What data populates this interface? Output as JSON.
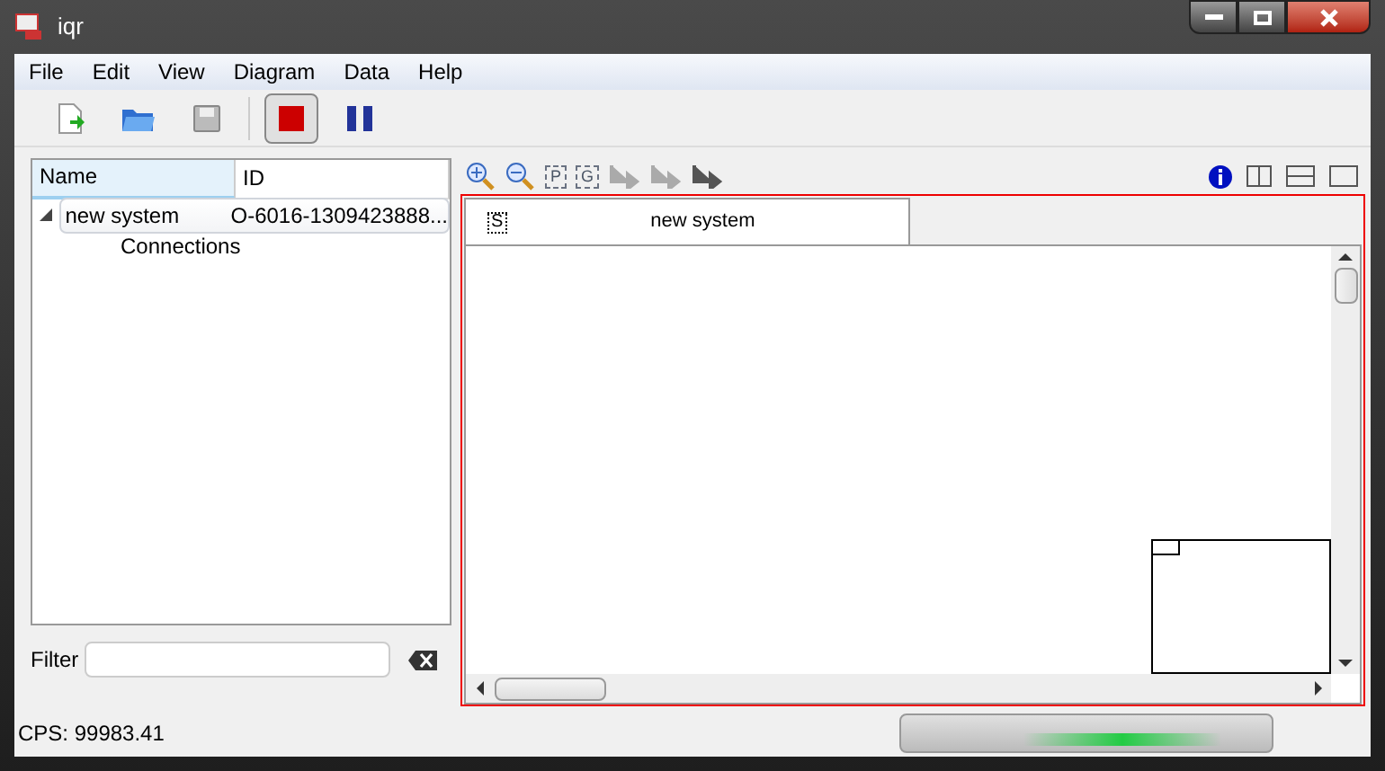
{
  "window": {
    "title": "iqr"
  },
  "menu": [
    "File",
    "Edit",
    "View",
    "Diagram",
    "Data",
    "Help"
  ],
  "toolbar": [
    {
      "kind": "new",
      "selected": false
    },
    {
      "kind": "open",
      "selected": false
    },
    {
      "kind": "save",
      "selected": false
    },
    {
      "kind": "stop",
      "selected": true
    },
    {
      "kind": "pause",
      "selected": false
    }
  ],
  "tree": {
    "columns": [
      "Name",
      "ID"
    ],
    "rows": [
      {
        "name": "new system",
        "id": "O-6016-1309423888...",
        "expanded": true,
        "selected": true,
        "children": [
          {
            "name": "Connections"
          }
        ]
      }
    ]
  },
  "filter": {
    "label": "Filter"
  },
  "diagram_toolbar": [
    {
      "kind": "zoom-in"
    },
    {
      "kind": "zoom-out"
    },
    {
      "kind": "letter",
      "label": "P"
    },
    {
      "kind": "letter",
      "label": "G"
    },
    {
      "kind": "arrow",
      "disabled": true
    },
    {
      "kind": "arrow",
      "disabled": true
    },
    {
      "kind": "arrow",
      "disabled": false
    }
  ],
  "tabs": [
    {
      "icon": "S",
      "label": "new system",
      "selected": true
    }
  ],
  "status_bar": {
    "cps": "CPS: 99983.41"
  }
}
